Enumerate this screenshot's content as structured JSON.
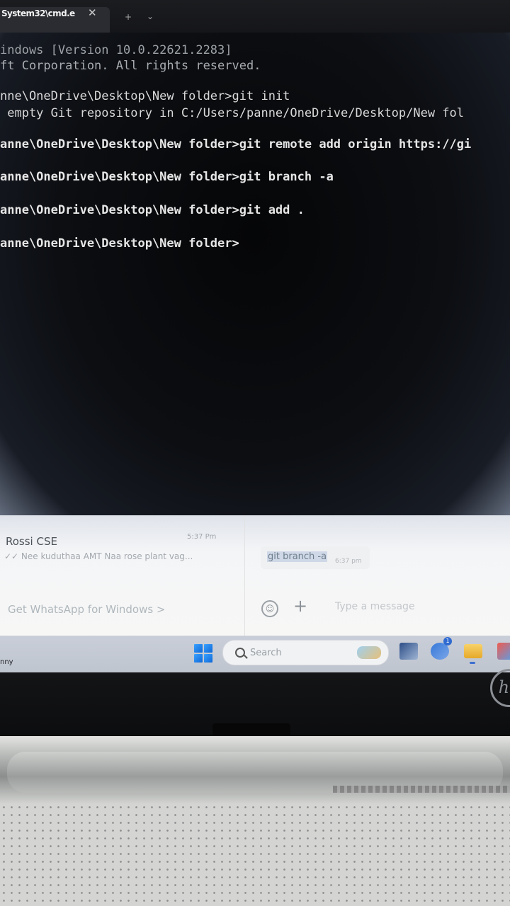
{
  "terminal": {
    "tab_title": "System32\\cmd.e",
    "tab_close_icon": "close-icon",
    "tab_new_icon": "plus-icon",
    "tab_dropdown_icon": "chevron-down-icon",
    "lines": [
      "indows [Version 10.0.22621.2283]",
      "ft Corporation. All rights reserved.",
      "nne\\OneDrive\\Desktop\\New folder>git init",
      " empty Git repository in C:/Users/panne/OneDrive/Desktop/New fol",
      "anne\\OneDrive\\Desktop\\New folder>git remote add origin https://gi",
      "anne\\OneDrive\\Desktop\\New folder>git branch -a",
      "anne\\OneDrive\\Desktop\\New folder>git add .",
      "anne\\OneDrive\\Desktop\\New folder>"
    ]
  },
  "whatsapp": {
    "chat_name": "Rossi CSE",
    "chat_time": "5:37 Pm",
    "chat_preview": "✓✓ Nee kuduthaa AMT Naa rose plant vag...",
    "message_text": "git branch -a",
    "message_time": "6:37 pm",
    "get_app_link": "Get WhatsApp for Windows >",
    "input_placeholder": "Type a message",
    "emoji_icon": "emoji-icon",
    "attach_icon": "plus-icon"
  },
  "taskbar": {
    "weather_text": "nny",
    "search_placeholder": "Search",
    "chat_badge": "1",
    "icons": [
      "windows-start-icon",
      "search-icon",
      "task-view-icon",
      "teams-chat-icon",
      "file-explorer-icon",
      "store-icon"
    ]
  },
  "laptop": {
    "brand_logo": "hp"
  }
}
